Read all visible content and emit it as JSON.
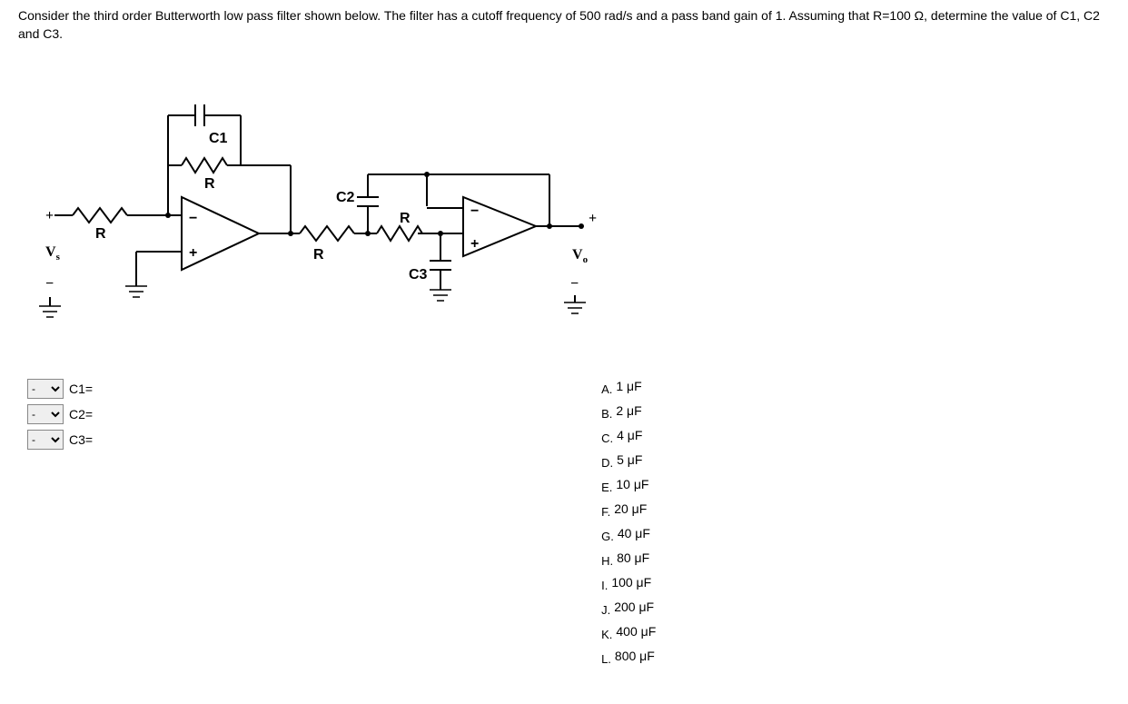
{
  "question": "Consider the third order Butterworth low pass filter shown below. The filter has a cutoff frequency of 500 rad/s and a pass band gain of 1. Assuming that R=100 Ω, determine the value of C1, C2 and C3.",
  "circuit": {
    "labels": {
      "C1": "C1",
      "C2": "C2",
      "C3": "C3",
      "R": "R",
      "Vs": "V",
      "Vs_sub": "s",
      "Vo": "V",
      "Vo_sub": "o",
      "plus": "+",
      "minus": "−"
    }
  },
  "dropdowns": [
    {
      "selected": "-",
      "label": "C1="
    },
    {
      "selected": "-",
      "label": "C2="
    },
    {
      "selected": "-",
      "label": "C3="
    }
  ],
  "choices": [
    {
      "letter": "A.",
      "value": "1 μF"
    },
    {
      "letter": "B.",
      "value": "2 μF"
    },
    {
      "letter": "C.",
      "value": "4 μF"
    },
    {
      "letter": "D.",
      "value": "5 μF"
    },
    {
      "letter": "E.",
      "value": "10 μF"
    },
    {
      "letter": "F.",
      "value": "20 μF"
    },
    {
      "letter": "G.",
      "value": "40 μF"
    },
    {
      "letter": "H.",
      "value": "80 μF"
    },
    {
      "letter": "I.",
      "value": "100 μF"
    },
    {
      "letter": "J.",
      "value": "200 μF"
    },
    {
      "letter": "K.",
      "value": "400 μF"
    },
    {
      "letter": "L.",
      "value": "800 μF"
    }
  ]
}
